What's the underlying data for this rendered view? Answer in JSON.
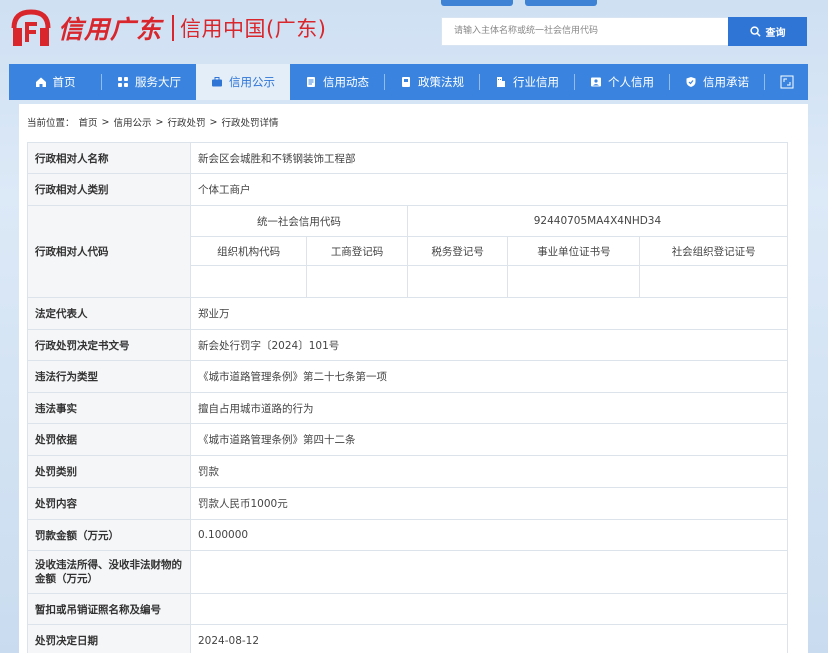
{
  "header": {
    "brand": "信用广东",
    "site_name": "信用中国(广东)",
    "search_placeholder": "请输入主体名称或统一社会信用代码",
    "search_button": "查询"
  },
  "nav": {
    "items": [
      {
        "label": "首页",
        "icon": "home-icon"
      },
      {
        "label": "服务大厅",
        "icon": "grid-icon"
      },
      {
        "label": "信用公示",
        "icon": "briefcase-icon",
        "active": true
      },
      {
        "label": "信用动态",
        "icon": "news-icon"
      },
      {
        "label": "政策法规",
        "icon": "book-icon"
      },
      {
        "label": "行业信用",
        "icon": "building-icon"
      },
      {
        "label": "个人信用",
        "icon": "id-card-icon"
      },
      {
        "label": "信用承诺",
        "icon": "shield-icon"
      }
    ],
    "expand_icon": "fullscreen-icon"
  },
  "breadcrumb": {
    "prefix": "当前位置：",
    "items": [
      "首页",
      "信用公示",
      "行政处罚",
      "行政处罚详情"
    ]
  },
  "record": {
    "party_name_label": "行政相对人名称",
    "party_name": "新会区会城胜和不锈钢装饰工程部",
    "party_type_label": "行政相对人类别",
    "party_type": "个体工商户",
    "party_code_label": "行政相对人代码",
    "uscc_label": "统一社会信用代码",
    "uscc": "92440705MA4X4NHD34",
    "code_headers": [
      "组织机构代码",
      "工商登记码",
      "税务登记号",
      "事业单位证书号",
      "社会组织登记证号"
    ],
    "code_values": [
      "",
      "",
      "",
      "",
      ""
    ],
    "legal_rep_label": "法定代表人",
    "legal_rep": "郑业万",
    "doc_no_label": "行政处罚决定书文号",
    "doc_no": "新会处行罚字〔2024〕101号",
    "violation_type_label": "违法行为类型",
    "violation_type": "《城市道路管理条例》第二十七条第一项",
    "facts_label": "违法事实",
    "facts": "擅自占用城市道路的行为",
    "basis_label": "处罚依据",
    "basis": "《城市道路管理条例》第四十二条",
    "category_label": "处罚类别",
    "category": "罚款",
    "content_label": "处罚内容",
    "content": "罚款人民币1000元",
    "amount_label": "罚款金额（万元）",
    "amount": "0.100000",
    "confiscated_label": "没收违法所得、没收非法财物的金额（万元）",
    "confiscated": "",
    "license_label": "暂扣或吊销证照名称及编号",
    "license": "",
    "decision_date_label": "处罚决定日期",
    "decision_date": "2024-08-12"
  },
  "colors": {
    "brand_red": "#d8262c",
    "nav_blue": "#3a84e0",
    "button_blue": "#2f75d6"
  }
}
